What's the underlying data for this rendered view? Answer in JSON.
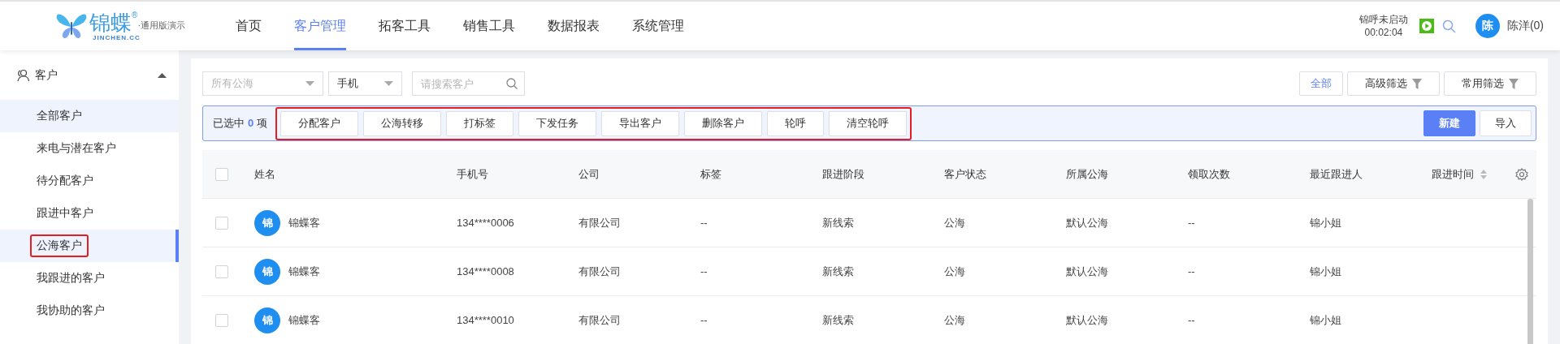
{
  "header": {
    "logo": {
      "brand": "锦蝶",
      "mark": "®",
      "tagline": "·通用版演示",
      "domain": "JINCHEN.CC"
    },
    "nav": [
      {
        "label": "首页",
        "selected": false
      },
      {
        "label": "客户管理",
        "selected": true
      },
      {
        "label": "拓客工具",
        "selected": false
      },
      {
        "label": "销售工具",
        "selected": false
      },
      {
        "label": "数据报表",
        "selected": false
      },
      {
        "label": "系统管理",
        "selected": false
      }
    ],
    "call_status": {
      "label": "锦呼未启动",
      "time": "00:02:04"
    },
    "user": {
      "avatar": "陈",
      "name": "陈洋(0)"
    }
  },
  "sidebar": {
    "group": {
      "label": "客户",
      "expanded": true
    },
    "items": [
      {
        "label": "全部客户",
        "selected": false,
        "hovered": true,
        "highlighted": false
      },
      {
        "label": "来电与潜在客户",
        "selected": false,
        "hovered": false,
        "highlighted": false
      },
      {
        "label": "待分配客户",
        "selected": false,
        "hovered": false,
        "highlighted": false
      },
      {
        "label": "跟进中客户",
        "selected": false,
        "hovered": false,
        "highlighted": false
      },
      {
        "label": "公海客户",
        "selected": true,
        "hovered": false,
        "highlighted": true
      },
      {
        "label": "我跟进的客户",
        "selected": false,
        "hovered": false,
        "highlighted": false
      },
      {
        "label": "我协助的客户",
        "selected": false,
        "hovered": false,
        "highlighted": false
      }
    ]
  },
  "filters": {
    "selects": [
      {
        "placeholder": "所有公海"
      },
      {
        "value": "手机"
      }
    ],
    "search": {
      "placeholder": "请搜索客户"
    },
    "quick": [
      {
        "label": "全部",
        "kind": "plain",
        "selected": true
      },
      {
        "label": "高级筛选",
        "kind": "filter",
        "selected": false
      },
      {
        "label": "常用筛选",
        "kind": "filter",
        "selected": false
      }
    ]
  },
  "selection": {
    "prefix": "已选中",
    "count": "0",
    "suffix": "项",
    "highlighted": true,
    "actions": [
      "分配客户",
      "公海转移",
      "打标签",
      "下发任务",
      "导出客户",
      "删除客户",
      "轮呼",
      "清空轮呼"
    ],
    "buttons": [
      {
        "label": "新建",
        "primary": true
      },
      {
        "label": "导入",
        "primary": false
      }
    ]
  },
  "table": {
    "columns": [
      {
        "label": "姓名",
        "sortable": false
      },
      {
        "label": "手机号",
        "sortable": false
      },
      {
        "label": "公司",
        "sortable": false
      },
      {
        "label": "标签",
        "sortable": false
      },
      {
        "label": "跟进阶段",
        "sortable": false
      },
      {
        "label": "客户状态",
        "sortable": false
      },
      {
        "label": "所属公海",
        "sortable": false
      },
      {
        "label": "领取次数",
        "sortable": false
      },
      {
        "label": "最近跟进人",
        "sortable": false
      },
      {
        "label": "跟进时间",
        "sortable": true
      }
    ],
    "header_checked": false,
    "rows": [
      {
        "checked": false,
        "avatar": "锦",
        "cells": [
          "锦蝶客",
          "134****0006",
          "有限公司",
          "--",
          "新线索",
          "公海",
          "默认公海",
          "--",
          "锦小姐"
        ]
      },
      {
        "checked": false,
        "avatar": "锦",
        "cells": [
          "锦蝶客",
          "134****0008",
          "有限公司",
          "--",
          "新线索",
          "公海",
          "默认公海",
          "--",
          "锦小姐"
        ]
      },
      {
        "checked": false,
        "avatar": "锦",
        "cells": [
          "锦蝶客",
          "134****0010",
          "有限公司",
          "--",
          "新线索",
          "公海",
          "默认公海",
          "--",
          "锦小姐"
        ]
      }
    ]
  }
}
